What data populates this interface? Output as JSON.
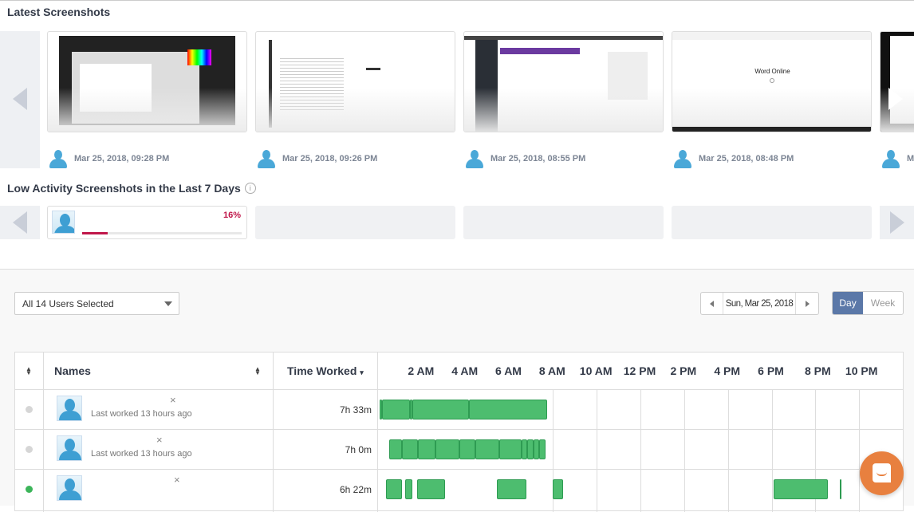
{
  "latest": {
    "title": "Latest Screenshots",
    "items": [
      {
        "time": "Mar 25, 2018, 09:28 PM"
      },
      {
        "time": "Mar 25, 2018, 09:26 PM"
      },
      {
        "time": "Mar 25, 2018, 08:55 PM"
      },
      {
        "time": "Mar 25, 2018, 08:48 PM",
        "thumb_text": "Word Online"
      },
      {
        "time": "M"
      }
    ]
  },
  "low_activity": {
    "title": "Low Activity Screenshots in the Last 7 Days",
    "items": [
      {
        "percent_label": "16%",
        "percent": 16
      }
    ],
    "bar_color": "#c0174a"
  },
  "filters": {
    "users_select": "All 14 Users Selected",
    "date": "Sun, Mar 25, 2018",
    "view_day": "Day",
    "view_week": "Week",
    "active_view": "Day"
  },
  "table": {
    "headers": {
      "names": "Names",
      "time_worked": "Time Worked"
    },
    "hours": [
      "2 AM",
      "4 AM",
      "6 AM",
      "8 AM",
      "10 AM",
      "12 PM",
      "2 PM",
      "4 PM",
      "6 PM",
      "8 PM",
      "10 PM"
    ],
    "rows": [
      {
        "status": "offline",
        "last_worked": "Last worked 13 hours ago",
        "time_worked": "7h 33m",
        "segments": [
          [
            0.07,
            0.18
          ],
          [
            0.18,
            1.46
          ],
          [
            1.46,
            1.57
          ],
          [
            1.57,
            4.15
          ],
          [
            4.15,
            7.72
          ]
        ]
      },
      {
        "status": "offline",
        "last_worked": "Last worked 13 hours ago",
        "time_worked": "7h 0m",
        "segments": [
          [
            0.51,
            1.09
          ],
          [
            1.09,
            1.82
          ],
          [
            1.82,
            2.62
          ],
          [
            2.62,
            3.71
          ],
          [
            3.71,
            4.44
          ],
          [
            4.44,
            5.53
          ],
          [
            5.53,
            6.55
          ],
          [
            6.55,
            6.81
          ],
          [
            6.81,
            7.1
          ],
          [
            7.1,
            7.36
          ],
          [
            7.36,
            7.65
          ]
        ]
      },
      {
        "status": "online",
        "last_worked": "",
        "time_worked": "6h 22m",
        "segments": [
          [
            0.36,
            1.09
          ],
          [
            1.24,
            1.57
          ],
          [
            1.78,
            3.06
          ],
          [
            5.43,
            6.77
          ],
          [
            7.98,
            8.45
          ],
          [
            18.1,
            20.58
          ],
          [
            21.12,
            21.2
          ]
        ]
      }
    ],
    "status_colors": {
      "offline": "#d6d6d6",
      "online": "#3cb55a"
    },
    "bar_color": "#4dbd6f"
  },
  "chat": {
    "icon": "chat-bubble-icon",
    "color": "#e8803f"
  }
}
